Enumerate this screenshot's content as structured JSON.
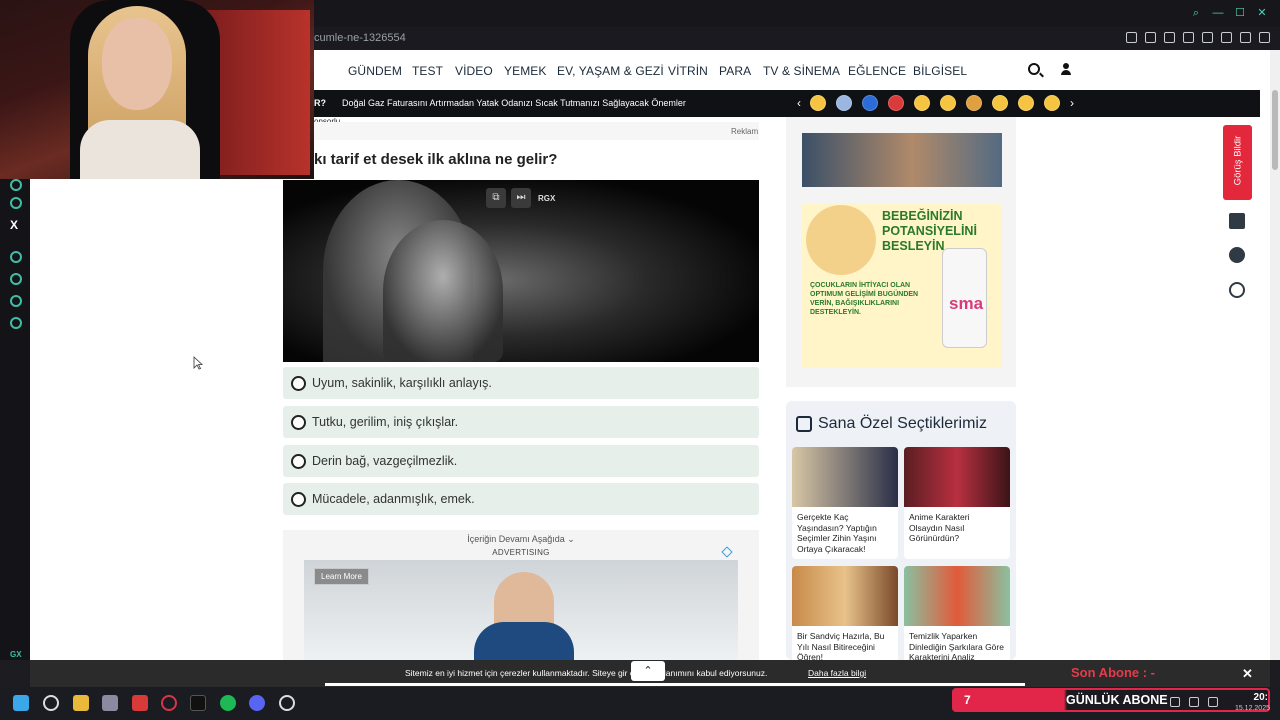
{
  "browser": {
    "url_fragment": "cumle-ne-1326554"
  },
  "nav": {
    "items": [
      "GÜNDEM",
      "TEST",
      "VİDEO",
      "YEMEK",
      "EV, YAŞAM & GEZİ",
      "VİTRİN",
      "PARA",
      "TV & SİNEMA",
      "EĞLENCE",
      "BİLGİSEL"
    ]
  },
  "ticker": {
    "prefix": "R?",
    "headline": "Doğal Gaz Faturasını Artırmadan Yatak Odanızı Sıcak Tutmanızı Sağlayacak Önemler"
  },
  "main": {
    "sponsor": "onsorlu",
    "ad_label": "Reklam",
    "question": "kı tarif et desek ilk aklına ne gelir?",
    "video_tag": "RGX",
    "options": [
      "Uyum, sakinlik, karşılıklı anlayış.",
      "Tutku, gerilim, iniş çıkışlar.",
      "Derin bağ, vazgeçilmezlik.",
      "Mücadele, adanmışlık, emek."
    ],
    "continue_label": "İçeriğin Devamı Aşağıda ⌄",
    "advertising_label": "ADVERTISING",
    "learn_more": "Learn More"
  },
  "right": {
    "baby_ad_title": "BEBEĞİNİZİN POTANSİYELİNİ BESLEYİN",
    "baby_ad_body": "ÇOCUKLARIN İHTİYACI OLAN OPTIMUM GELİŞİMİ BUGÜNDEN VERİN, BAĞIŞIKLIKLARINI DESTEKLEYİN.",
    "baby_ad_brand": "sma",
    "picks_title": "Sana Özel Seçtiklerimiz",
    "cards": [
      "Gerçekte Kaç Yaşındasın? Yaptığın Seçimler Zihin Yaşını Ortaya Çıkaracak!",
      "Anime Karakteri Olsaydın Nasıl Görünürdün?",
      "Bir Sandviç Hazırla, Bu Yılı Nasıl Bitireceğini Öğren!",
      "Temizlik Yaparken Dinlediğin Şarkılara Göre Karakterini Analiz Ediyoruz!"
    ],
    "feedback_label": "Görüş Bildir"
  },
  "cookie": {
    "text": "Sitemiz en iyi hizmet için çerezler kullanmaktadır. Siteye gir          çerez kullanımını kabul ediyorsunuz.",
    "link": "Daha fazla bilgi",
    "close": "✕"
  },
  "overlay": {
    "son_abone": "Son Abone : -",
    "abone_count": "7",
    "abone_label": "GÜNLÜK ABONE"
  },
  "taskbar": {
    "time": "20:",
    "date": "15.12.2025"
  },
  "colors": {
    "accent_teal": "#3fbfa6",
    "feedback_red": "#e3283c",
    "option_bg": "#e6efea",
    "abone_red": "#e2264a"
  }
}
